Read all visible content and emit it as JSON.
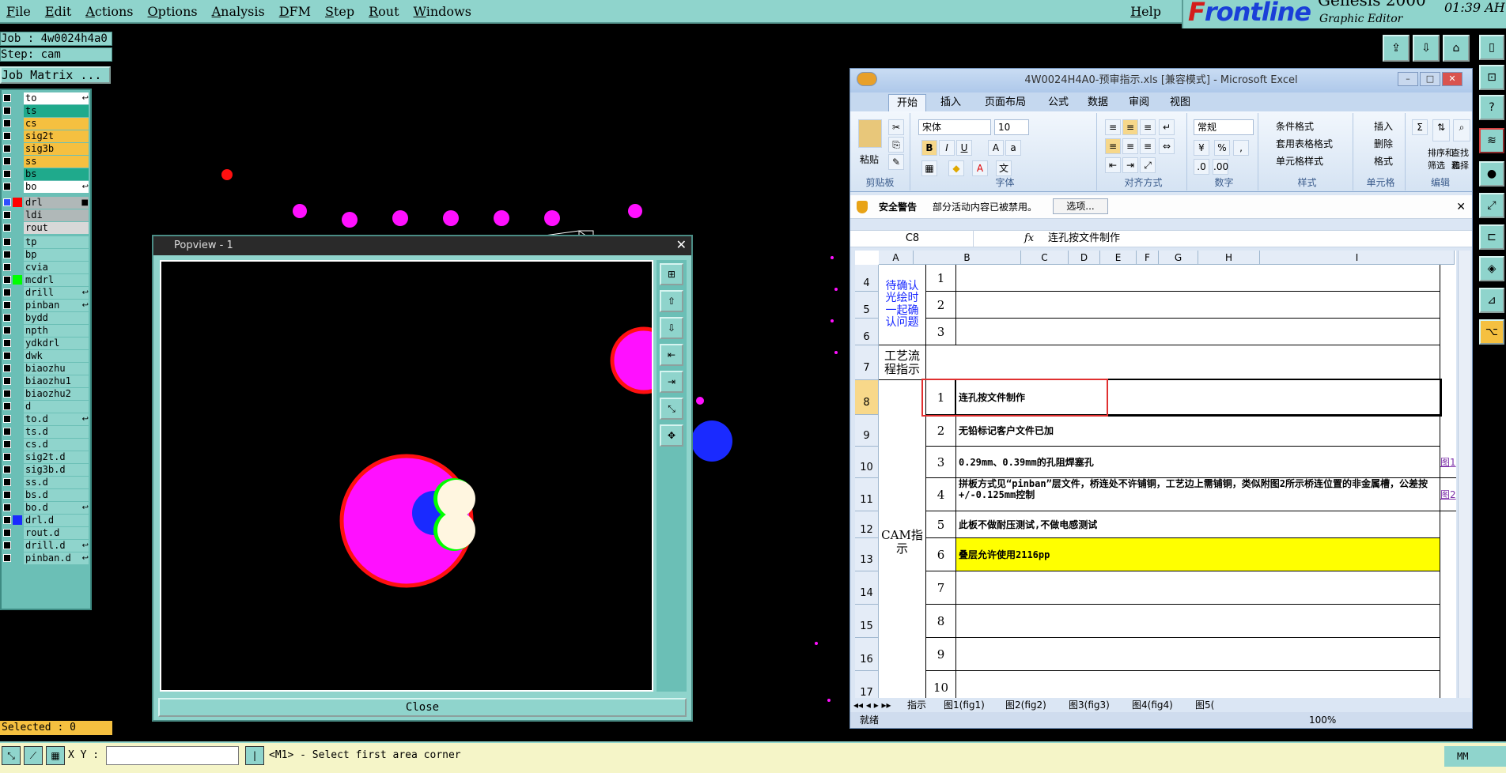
{
  "menu": {
    "items": [
      "File",
      "Edit",
      "Actions",
      "Options",
      "Analysis",
      "DFM",
      "Step",
      "Rout",
      "Windows"
    ],
    "help": "Help"
  },
  "logo": {
    "brand_pre": "F",
    "brand_rest": "rontline",
    "product": "Genesis 2000",
    "subtitle": "Graphic Editor",
    "clock": "01:39 AH"
  },
  "left": {
    "job": "Job : 4w0024h4a0",
    "step": "Step: cam",
    "job_matrix": "Job Matrix ...",
    "layers": [
      {
        "name": "to",
        "color": "#ffffff",
        "mark": "↩"
      },
      {
        "name": "ts",
        "color": "#1faa8c",
        "mark": ""
      },
      {
        "name": "cs",
        "color": "#f5c040",
        "mark": ""
      },
      {
        "name": "sig2t",
        "color": "#f5c040",
        "mark": ""
      },
      {
        "name": "sig3b",
        "color": "#f5c040",
        "mark": ""
      },
      {
        "name": "ss",
        "color": "#f5c040",
        "mark": ""
      },
      {
        "name": "bs",
        "color": "#1faa8c",
        "mark": ""
      },
      {
        "name": "bo",
        "color": "#ffffff",
        "mark": "↩"
      },
      {
        "name": "drl",
        "color": "#b0b8b8",
        "mark": "■",
        "swatch": "#ff0000",
        "cbfill": "#3050ff"
      },
      {
        "name": "ldi",
        "color": "#b0b8b8",
        "mark": ""
      },
      {
        "name": "rout",
        "color": "#d8d8d8",
        "mark": ""
      },
      {
        "name": "tp",
        "color": "#8fd4cc",
        "mark": ""
      },
      {
        "name": "bp",
        "color": "#8fd4cc",
        "mark": ""
      },
      {
        "name": "cvia",
        "color": "#8fd4cc",
        "mark": ""
      },
      {
        "name": "mcdrl",
        "color": "#8fd4cc",
        "mark": "",
        "swatch": "#00ff00"
      },
      {
        "name": "drill",
        "color": "#8fd4cc",
        "mark": "↩"
      },
      {
        "name": "pinban",
        "color": "#8fd4cc",
        "mark": "↩"
      },
      {
        "name": "bydd",
        "color": "#8fd4cc",
        "mark": ""
      },
      {
        "name": "npth",
        "color": "#8fd4cc",
        "mark": ""
      },
      {
        "name": "ydkdrl",
        "color": "#8fd4cc",
        "mark": ""
      },
      {
        "name": "dwk",
        "color": "#8fd4cc",
        "mark": ""
      },
      {
        "name": "biaozhu",
        "color": "#8fd4cc",
        "mark": ""
      },
      {
        "name": "biaozhu1",
        "color": "#8fd4cc",
        "mark": ""
      },
      {
        "name": "biaozhu2",
        "color": "#8fd4cc",
        "mark": ""
      },
      {
        "name": "d",
        "color": "#8fd4cc",
        "mark": ""
      },
      {
        "name": "to.d",
        "color": "#8fd4cc",
        "mark": "↩"
      },
      {
        "name": "ts.d",
        "color": "#8fd4cc",
        "mark": ""
      },
      {
        "name": "cs.d",
        "color": "#8fd4cc",
        "mark": ""
      },
      {
        "name": "sig2t.d",
        "color": "#8fd4cc",
        "mark": ""
      },
      {
        "name": "sig3b.d",
        "color": "#8fd4cc",
        "mark": ""
      },
      {
        "name": "ss.d",
        "color": "#8fd4cc",
        "mark": ""
      },
      {
        "name": "bs.d",
        "color": "#8fd4cc",
        "mark": ""
      },
      {
        "name": "bo.d",
        "color": "#8fd4cc",
        "mark": "↩"
      },
      {
        "name": "drl.d",
        "color": "#8fd4cc",
        "mark": "",
        "swatch": "#1a2aff"
      },
      {
        "name": "rout.d",
        "color": "#8fd4cc",
        "mark": ""
      },
      {
        "name": "drill.d",
        "color": "#8fd4cc",
        "mark": "↩"
      },
      {
        "name": "pinban.d",
        "color": "#8fd4cc",
        "mark": "↩"
      }
    ],
    "selected": "Selected : 0"
  },
  "bottom": {
    "xy_label": "X Y :",
    "xy_value": "",
    "prompt": "<M1> - Select first area corner",
    "units": "MM"
  },
  "popview": {
    "title": "Popview - 1",
    "close": "Close"
  },
  "excel": {
    "title": "4W0024H4A0-预审指示.xls [兼容模式] - Microsoft Excel",
    "tabs": [
      "开始",
      "插入",
      "页面布局",
      "公式",
      "数据",
      "审阅",
      "视图"
    ],
    "ribbon": {
      "paste": "粘贴",
      "clipboard": "剪贴板",
      "font_name": "宋体",
      "font_size": "10",
      "font_group": "字体",
      "align_group": "对齐方式",
      "num_format": "常规",
      "num_group": "数字",
      "cond_format": "条件格式",
      "table_format": "套用表格格式",
      "cell_style": "单元格样式",
      "style_group": "样式",
      "insert": "插入",
      "delete": "删除",
      "format": "格式",
      "cells_group": "单元格",
      "sort": "排序和",
      "filter": "筛选",
      "find": "查找和",
      "select": "选择",
      "edit_group": "编辑"
    },
    "security": {
      "title": "安全警告",
      "text": "部分活动内容已被禁用。",
      "options": "选项..."
    },
    "namebox": "C8",
    "formula": "连孔按文件制作",
    "columns": [
      "A",
      "B",
      "C",
      "D",
      "E",
      "F",
      "G",
      "H",
      "I"
    ],
    "rows": [
      {
        "r": "4",
        "num": "1",
        "text": ""
      },
      {
        "r": "5",
        "num": "2",
        "text": ""
      },
      {
        "r": "6",
        "num": "3",
        "text": ""
      },
      {
        "r": "7",
        "num": "",
        "text": ""
      },
      {
        "r": "8",
        "num": "1",
        "text": "连孔按文件制作"
      },
      {
        "r": "9",
        "num": "2",
        "text": "无铅标记客户文件已加"
      },
      {
        "r": "10",
        "num": "3",
        "text": "0.29mm、0.39mm的孔阻焊塞孔",
        "link": "图1"
      },
      {
        "r": "11",
        "num": "4",
        "text": "拼板方式见“pinban”层文件，桥连处不许铺铜，工艺边上需铺铜，类似附图2所示桥连位置的非金属槽，公差按+/-0.125mm控制",
        "link": "图2"
      },
      {
        "r": "12",
        "num": "5",
        "text": "此板不做耐压测试,不做电感测试"
      },
      {
        "r": "13",
        "num": "6",
        "text": "叠层允许使用2116pp"
      },
      {
        "r": "14",
        "num": "7",
        "text": ""
      },
      {
        "r": "15",
        "num": "8",
        "text": ""
      },
      {
        "r": "16",
        "num": "9",
        "text": ""
      },
      {
        "r": "17",
        "num": "10",
        "text": ""
      }
    ],
    "group_labels": {
      "pending": "待确认光绘时一起确认问题",
      "process": "工艺流程指示",
      "cam": "CAM指示"
    },
    "sheets": [
      "指示",
      "图1(fig1)",
      "图2(fig2)",
      "图3(fig3)",
      "图4(fig4)",
      "图5("
    ],
    "status": "就绪",
    "zoom": "100%"
  }
}
